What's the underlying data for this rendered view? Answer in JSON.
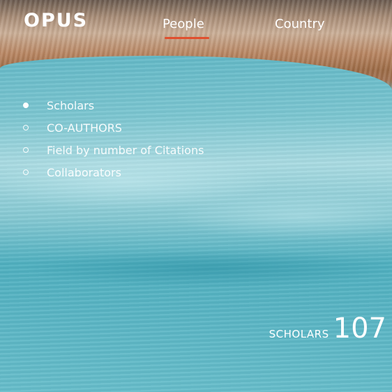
{
  "header": {
    "logo": "OPUS",
    "nav": [
      {
        "label": "People",
        "active": true
      },
      {
        "label": "Country",
        "active": false
      }
    ]
  },
  "menu": {
    "items": [
      {
        "label": "Scholars",
        "selected": true
      },
      {
        "label": "CO-AUTHORS",
        "selected": false
      },
      {
        "label": "Field by number of Citations",
        "selected": false
      },
      {
        "label": "Collaborators",
        "selected": false
      }
    ]
  },
  "stat": {
    "label": "SCHOLARS",
    "value": "107"
  },
  "colors": {
    "accent_underline": "#e0502e",
    "water": "#5cb8c6",
    "sand": "#b78460",
    "text": "#ffffff"
  }
}
